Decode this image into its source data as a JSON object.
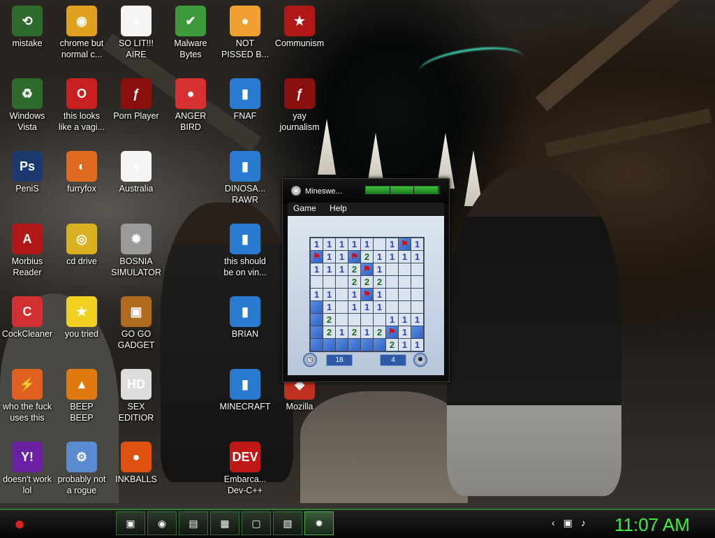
{
  "desktop": {
    "icons": [
      {
        "label1": "mistake",
        "label2": "",
        "glyph": "⟲",
        "color": "#2d6b2d"
      },
      {
        "label1": "chrome but",
        "label2": "normal c...",
        "glyph": "◉",
        "color": "#e0a020"
      },
      {
        "label1": "SO LIT!!!",
        "label2": "AIRE",
        "glyph": "♠",
        "color": "#f5f5f5"
      },
      {
        "label1": "Malware",
        "label2": "Bytes",
        "glyph": "✔",
        "color": "#3c9a3c"
      },
      {
        "label1": "NOT",
        "label2": "PISSED B...",
        "glyph": "●",
        "color": "#f0a030"
      },
      {
        "label1": "Communism",
        "label2": "",
        "glyph": "★",
        "color": "#b01818"
      },
      {
        "label1": "Windows",
        "label2": "Vista",
        "glyph": "♻",
        "color": "#2d6b2d"
      },
      {
        "label1": "this looks",
        "label2": "like a vagi...",
        "glyph": "O",
        "color": "#c82020"
      },
      {
        "label1": "Porn Player",
        "label2": "",
        "glyph": "ƒ",
        "color": "#8a1010"
      },
      {
        "label1": "ANGER",
        "label2": "BIRD",
        "glyph": "●",
        "color": "#d83030"
      },
      {
        "label1": "FNAF",
        "label2": "",
        "glyph": "▮",
        "color": "#2a7ad0"
      },
      {
        "label1": "yay",
        "label2": "journalism",
        "glyph": "ƒ",
        "color": "#8a1010"
      },
      {
        "label1": "PeniS",
        "label2": "",
        "glyph": "Ps",
        "color": "#1c3a6e"
      },
      {
        "label1": "furryfox",
        "label2": "",
        "glyph": "◐",
        "color": "#e06a20"
      },
      {
        "label1": "Australia",
        "label2": "",
        "glyph": "♠",
        "color": "#f5f5f5"
      },
      {
        "label1": "DINOSA...",
        "label2": "RAWR",
        "glyph": "▮",
        "color": "#2a7ad0"
      },
      {
        "label1": "Morbius",
        "label2": "Reader",
        "glyph": "A",
        "color": "#b01818"
      },
      {
        "label1": "cd drive",
        "label2": "",
        "glyph": "◎",
        "color": "#d8b020"
      },
      {
        "label1": "BOSNIA",
        "label2": "SIMULATOR",
        "glyph": "✹",
        "color": "#9a9a9a"
      },
      {
        "label1": "this should",
        "label2": "be on vin...",
        "glyph": "▮",
        "color": "#2a7ad0"
      },
      {
        "label1": "CockCleaner",
        "label2": "",
        "glyph": "C",
        "color": "#d03030"
      },
      {
        "label1": "you tried",
        "label2": "",
        "glyph": "★",
        "color": "#f0d020"
      },
      {
        "label1": "GO GO",
        "label2": "GADGET",
        "glyph": "▣",
        "color": "#b06a20"
      },
      {
        "label1": "BRIAN",
        "label2": "",
        "glyph": "▮",
        "color": "#2a7ad0"
      },
      {
        "label1": "who the fuck",
        "label2": "uses this",
        "glyph": "⚡",
        "color": "#e06020"
      },
      {
        "label1": "BEEP",
        "label2": "BEEP",
        "glyph": "▲",
        "color": "#e07a10"
      },
      {
        "label1": "SEX",
        "label2": "EDITIOR",
        "glyph": "HD",
        "color": "#ddd"
      },
      {
        "label1": "MINECRAFT",
        "label2": "",
        "glyph": "▮",
        "color": "#2a7ad0"
      },
      {
        "label1": "Mozilla",
        "label2": "",
        "glyph": "◆",
        "color": "#c03020"
      },
      {
        "label1": "doesn't work",
        "label2": "lol",
        "glyph": "Y!",
        "color": "#6a20a0"
      },
      {
        "label1": "probably not",
        "label2": "a rogue",
        "glyph": "⚙",
        "color": "#5a8ad0"
      },
      {
        "label1": "INKBALLS",
        "label2": "",
        "glyph": "●",
        "color": "#e05010"
      },
      {
        "label1": "Embarca...",
        "label2": "Dev-C++",
        "glyph": "DEV",
        "color": "#c01818"
      }
    ]
  },
  "minesweeper": {
    "title": "Mineswe...",
    "menu": {
      "game": "Game",
      "help": "Help"
    },
    "timer": "18",
    "mines_left": "4",
    "rows": [
      [
        "1",
        "1",
        "1",
        "1",
        "1",
        "o",
        "1",
        "F",
        "1"
      ],
      [
        "F",
        "1",
        "1",
        "F",
        "2",
        "1",
        "1",
        "1",
        "1"
      ],
      [
        "1",
        "1",
        "1",
        "2",
        "F",
        "1",
        "o",
        "o",
        "o"
      ],
      [
        "o",
        "o",
        "o",
        "2",
        "2",
        "2",
        "o",
        "o",
        "o"
      ],
      [
        "1",
        "1",
        "o",
        "1",
        "F",
        "1",
        "o",
        "o",
        "o"
      ],
      [
        "C",
        "1",
        "o",
        "1",
        "1",
        "1",
        "o",
        "o",
        "o"
      ],
      [
        "C",
        "2",
        "o",
        "o",
        "o",
        "o",
        "1",
        "1",
        "1"
      ],
      [
        "C",
        "2",
        "1",
        "2",
        "1",
        "2",
        "F",
        "1",
        "C"
      ],
      [
        "C",
        "C",
        "C",
        "C",
        "C",
        "C",
        "2",
        "1",
        "1"
      ]
    ]
  },
  "taskbar": {
    "clock": "11:07 AM",
    "tasks": [
      "folder-icon",
      "chrome-icon",
      "player-icon",
      "devcpp-icon",
      "window-icon",
      "picture-icon",
      "minesweeper-icon"
    ]
  }
}
